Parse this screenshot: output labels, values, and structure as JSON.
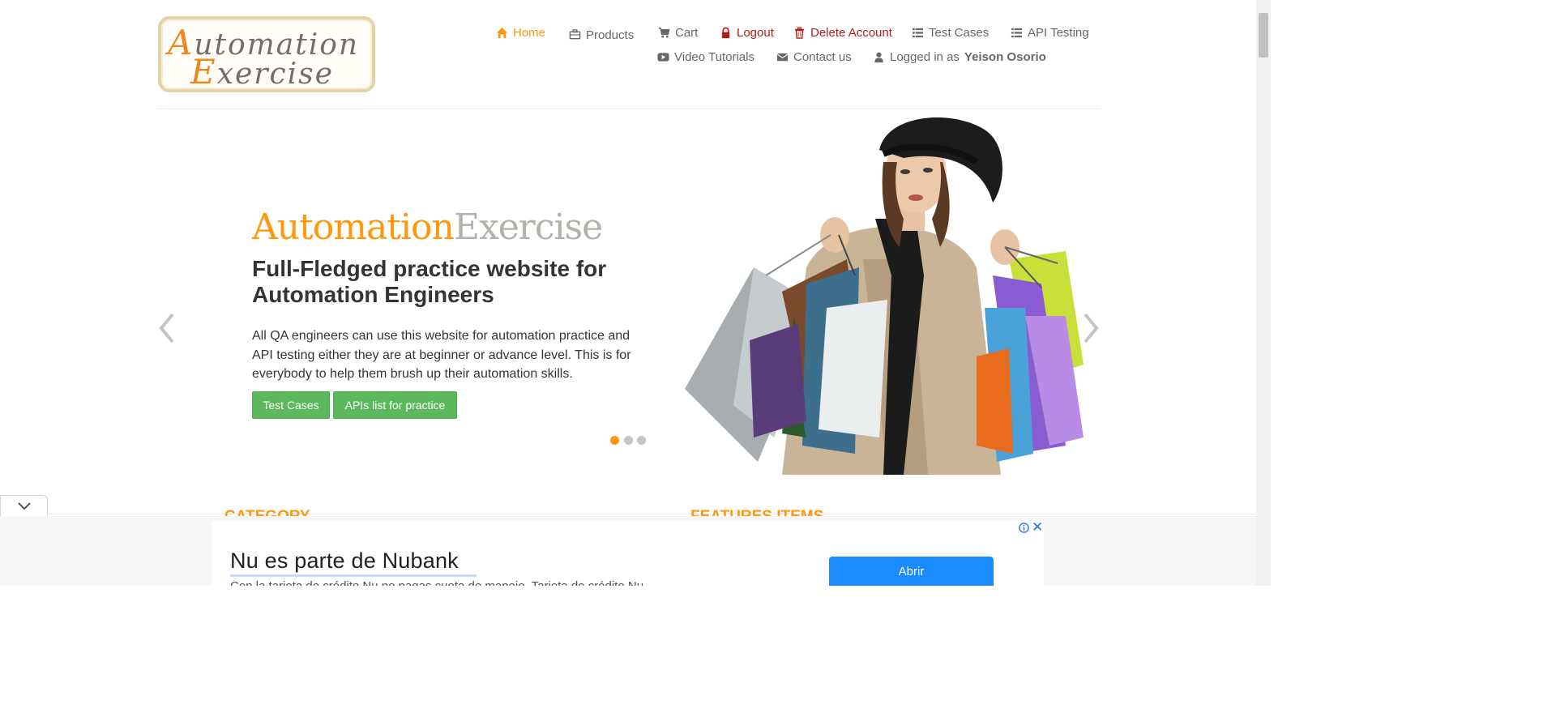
{
  "logo": {
    "line1_cap": "A",
    "line1_rest": "utomation",
    "line2_cap": "E",
    "line2_rest": "xercise"
  },
  "nav": {
    "home": "Home",
    "products": "Products",
    "cart": "Cart",
    "logout": "Logout",
    "delete_account": "Delete Account",
    "test_cases": "Test Cases",
    "api_testing": "API Testing",
    "video_tutorials": "Video Tutorials",
    "contact_us": "Contact us",
    "logged_in_prefix": "Logged in as",
    "username": "Yeison Osorio"
  },
  "slider": {
    "brand_a": "Automation",
    "brand_b": "Exercise",
    "headline": "Full-Fledged practice website for Automation Engineers",
    "description": "All QA engineers can use this website for automation practice and API testing either they are at beginner or advance level. This is for everybody to help them brush up their automation skills.",
    "btn_test_cases": "Test Cases",
    "btn_apis": "APIs list for practice",
    "active_slide": 1,
    "slide_count": 3
  },
  "sections": {
    "left_title": "CATEGORY",
    "right_title": "FEATURES ITEMS"
  },
  "ad": {
    "title": "Nu es parte de Nubank",
    "text": "Con la tarjeta de crédito Nu no pagas cuota de manejo. Tarjeta de crédito Nu",
    "button": "Abrir"
  },
  "colors": {
    "accent": "#fe980f",
    "danger": "#b31b1b",
    "button_green": "#5cb85c",
    "ad_blue": "#1a8cff"
  }
}
